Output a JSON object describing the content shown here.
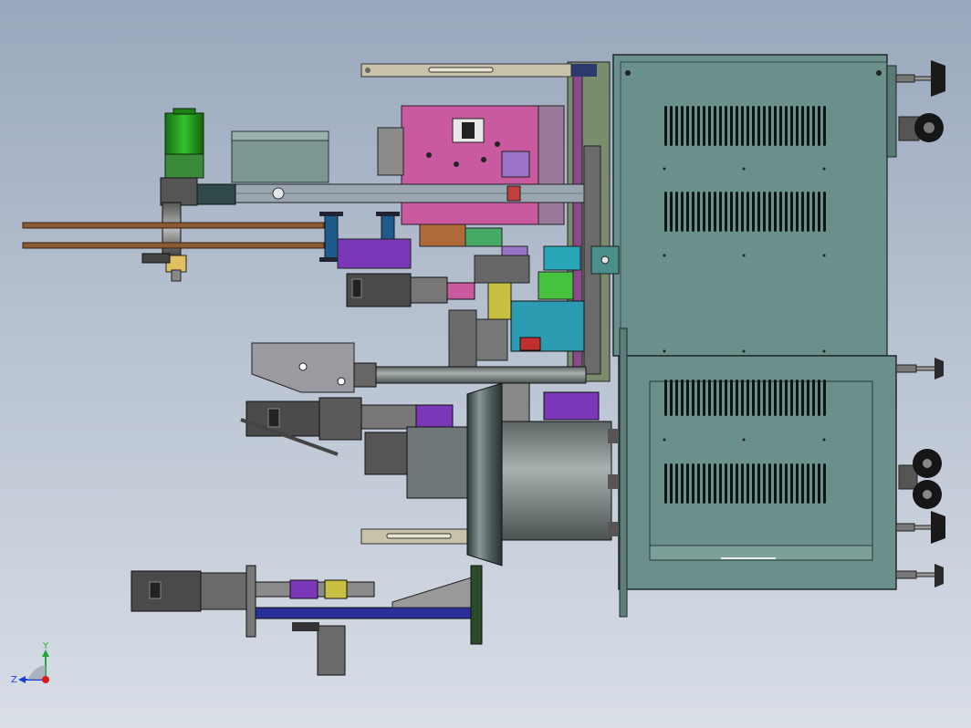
{
  "scene": {
    "title": "",
    "background_top": "#9aa8bd",
    "background_bottom": "#d9dee7"
  },
  "triad": {
    "y_label": "Y",
    "z_label": "Z",
    "y_color": "#1fa83a",
    "z_color": "#1a3cd8",
    "x_dot_color": "#e01818"
  },
  "colors": {
    "cabinet": "#6b8f8a",
    "cabinet_dark": "#3f5e5a",
    "motor": "#4a4a4a",
    "green_motor": "#25a020",
    "magenta_block": "#c95a9f",
    "teal_part": "#2a9bb0",
    "purple_part": "#7a38b8",
    "blue_rail": "#2a2f9a",
    "copper_rod": "#8a5a32",
    "bowl": "#5f6c6c"
  },
  "parts": [
    {
      "name": "upper-electrical-cabinet"
    },
    {
      "name": "lower-electrical-cabinet"
    },
    {
      "name": "vibratory-bowl-feeder"
    },
    {
      "name": "servo-motor"
    },
    {
      "name": "green-gear-motor"
    },
    {
      "name": "leveling-foot"
    },
    {
      "name": "caster-wheel"
    }
  ]
}
